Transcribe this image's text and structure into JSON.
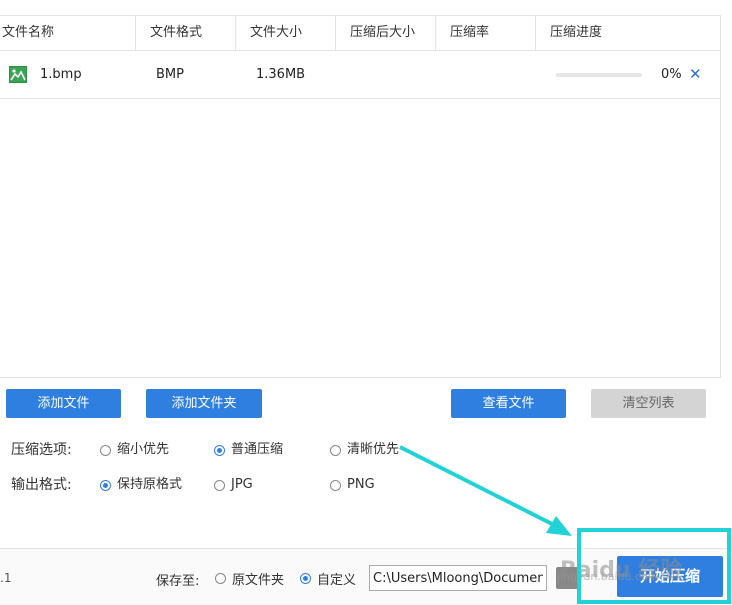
{
  "table": {
    "headers": [
      "文件名称",
      "文件格式",
      "文件大小",
      "压缩后大小",
      "压缩率",
      "压缩进度"
    ],
    "rows": [
      {
        "name": "1.bmp",
        "format": "BMP",
        "size": "1.36MB",
        "compressed_size": "",
        "ratio": "",
        "progress": 0,
        "progress_text": "0%",
        "remove": "✕"
      }
    ]
  },
  "actions": {
    "add_file": "添加文件",
    "add_folder": "添加文件夹",
    "view_files": "查看文件",
    "clear_list": "清空列表"
  },
  "options": {
    "compress_label": "压缩选项:",
    "compress_choices": [
      "缩小优先",
      "普通压缩",
      "清晰优先"
    ],
    "compress_selected": 1,
    "format_label": "输出格式:",
    "format_choices": [
      "保持原格式",
      "JPG",
      "PNG"
    ],
    "format_selected": 0
  },
  "bottom": {
    "version_tail": ".1",
    "save_label": "保存至:",
    "save_choices": [
      "原文件夹",
      "自定义"
    ],
    "save_selected": 1,
    "path_value": "C:\\Users\\Mloong\\Documents",
    "start": "开始压缩"
  },
  "watermark": {
    "main": "Baidu 经验",
    "sub": "jingyan.baidu.com"
  },
  "colors": {
    "accent": "#2f7fe0",
    "highlight": "#21d2d6",
    "disabled": "#d4d4d4"
  }
}
